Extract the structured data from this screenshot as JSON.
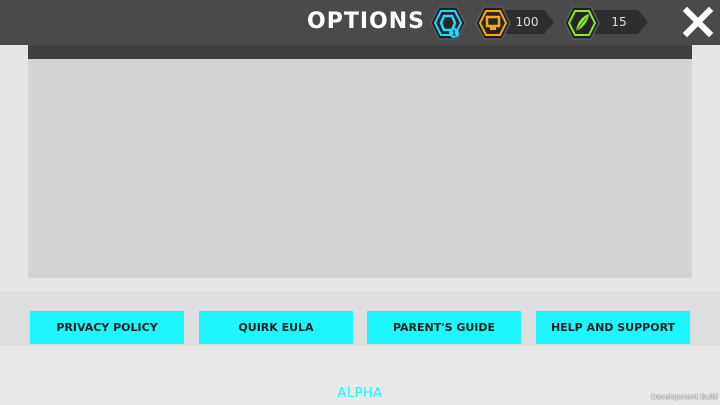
{
  "header": {
    "title": "OPTIONS",
    "currencies": [
      {
        "icon": "cyan-gem-hex-icon",
        "badge": "1",
        "color": "#26d9ff"
      },
      {
        "icon": "gold-coin-hex-icon",
        "amount": "100",
        "color": "#f5a623"
      },
      {
        "icon": "green-leaf-hex-icon",
        "amount": "15",
        "color": "#8fe62a"
      }
    ],
    "close_icon": "close-icon"
  },
  "footer_links": [
    {
      "label": "PRIVACY POLICY"
    },
    {
      "label": "QUIRK EULA"
    },
    {
      "label": "PARENT'S GUIDE"
    },
    {
      "label": "HELP AND SUPPORT"
    }
  ],
  "build": {
    "channel": "ALPHA",
    "note": "Development Build"
  },
  "colors": {
    "accent": "#1ef6ff",
    "topbar": "#4a4a4a"
  }
}
